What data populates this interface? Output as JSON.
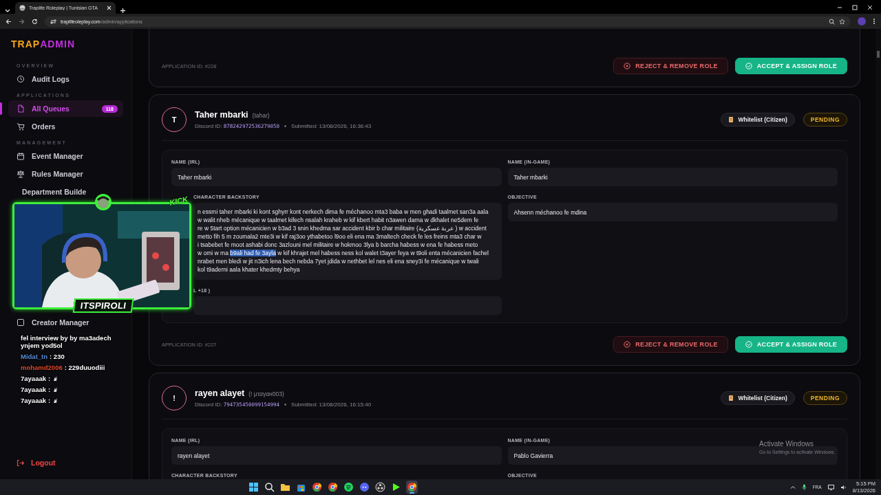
{
  "browser": {
    "tab_title": "Traplife Roleplay | Tunisian GTA",
    "url_host": "traplifeoleplay.com",
    "url_path": "/admin/applications"
  },
  "sidebar": {
    "logo_start": "TRAP",
    "logo_end": "ADMIN",
    "sections": [
      {
        "title": "OVERVIEW",
        "items": [
          {
            "label": "Audit Logs",
            "selected": false
          }
        ]
      },
      {
        "title": "APPLICATIONS",
        "items": [
          {
            "label": "All Queues",
            "selected": true,
            "badge": "118"
          },
          {
            "label": "Orders",
            "selected": false
          }
        ]
      },
      {
        "title": "MANAGEMENT",
        "items": [
          {
            "label": "Event Manager",
            "selected": false
          },
          {
            "label": "Rules Manager",
            "selected": false
          },
          {
            "label": "Department Builde",
            "selected": false,
            "partly_hidden": true
          },
          {
            "label": "Creator Manager",
            "selected": false
          }
        ]
      }
    ],
    "logout": "Logout"
  },
  "applications": [
    {
      "kind": "footer",
      "application_id": "APPLICATION ID: #228",
      "actions": [
        "REJECT & REMOVE ROLE",
        "ACCEPT & ASSIGN ROLE"
      ]
    },
    {
      "kind": "full",
      "initial": "T",
      "name": "Taher mbarki",
      "handle": "(tahar)",
      "discord_label": "Discord ID:",
      "discord_id": "878242972536279050",
      "submitted": "Submitted: 13/08/2026, 16:36:43",
      "role": "Whitelist (Citizen)",
      "status": "PENDING",
      "fields": [
        {
          "kind": "text",
          "label": "NAME (IRL)",
          "value": "Taher mbarki"
        },
        {
          "kind": "text",
          "label": "NAME (IN-GAME)",
          "value": "Taher mbarki"
        },
        {
          "kind": "multiline",
          "label": "CHARACTER BACKSTORY",
          "partly_hidden": true,
          "lines": [
            [
              {
                "text": "n essmi taher mbarki ki kont sghyrr kont nerkech dima fe méchanoo mta3 baba w men ghadi taalmet san3a aala",
                "selected": false
              }
            ],
            [
              {
                "text": "w walit nheb mécanique w taalmet kifech nsalah kraheb w kif kbert habit n3awen darna w dkhalet ne5dem fe",
                "selected": false
              }
            ],
            [
              {
                "text": "re w 5tart option mécanicien w b3ad 3 snin khedma sar accident kbir b char militaire (عربة عسكرية ) w accident",
                "selected": false
              }
            ],
            [
              {
                "text": "metto fih 5 m zoumala2 mte3i w kif raj3oo ythabetoo l9oo eli ena ma 3maltech check fe les freins mta3 char w",
                "selected": false
              }
            ],
            [
              {
                "text": "i tsabebet fe moot ashabi donc 3azlouni mel militaire w hokmoo 3lya b barcha habess w ena fe habess meto",
                "selected": false
              }
            ],
            [
              {
                "text": "w omi w ma ",
                "selected": false
              },
              {
                "text": "b9ali had fe 3ayla",
                "selected": true
              },
              {
                "text": " w kif khrajet mel habess ness kol walet t3ayer feya w t9oli enta mécanicien fachel",
                "selected": false
              }
            ],
            [
              {
                "text": "nrabet men bledi w jit n3ich lena bech nebda 7yet jdida w nethbet lel nes eli ena sney3i fe mécanique w twali",
                "selected": false
              }
            ],
            [
              {
                "text": "kol t9aderni aala khater khedmty behya",
                "selected": false
              }
            ]
          ]
        },
        {
          "kind": "text",
          "label": "OBJECTIVE",
          "value": "Ahsenn méchanoo fe mdina"
        },
        {
          "kind": "text",
          "label": "L +18 )",
          "partly_hidden": true
        }
      ],
      "application_id": "APPLICATION ID: #227",
      "actions": [
        "REJECT & REMOVE ROLE",
        "ACCEPT & ASSIGN ROLE"
      ]
    },
    {
      "kind": "full",
      "initial": "!",
      "name": "rayen alayet",
      "handle": "(! μταγαн003)",
      "discord_label": "Discord ID:",
      "discord_id": "794735450099154994",
      "submitted": "Submitted: 13/08/2026, 16:15:40",
      "role": "Whitelist (Citizen)",
      "status": "PENDING",
      "fields": [
        {
          "kind": "text",
          "label": "NAME (IRL)",
          "value": "rayen alayet"
        },
        {
          "kind": "text",
          "label": "NAME (IN-GAME)",
          "value": "Pablo Gavierra"
        },
        {
          "kind": "label",
          "label": "CHARACTER BACKSTORY"
        },
        {
          "kind": "label",
          "label": "OBJECTIVE"
        }
      ]
    }
  ],
  "stream_overlay": {
    "streamer": "ITSPIROLI",
    "platform": "KICK",
    "chat": [
      {
        "kind": "text",
        "message": "fel interview by by ma3adech ynjem yod5ol"
      },
      {
        "kind": "text",
        "user": "Midat_tn",
        "color": "#5b8ed8",
        "message": ": 230"
      },
      {
        "kind": "text",
        "user": "mohamd2006",
        "color": "#e04a2c",
        "message": ": 229duuodiii"
      },
      {
        "kind": "emote",
        "user": "7ayaaak",
        "color": "#ffffff",
        "message": ":"
      },
      {
        "kind": "emote",
        "user": "7ayaaak",
        "color": "#ffffff",
        "message": ":"
      },
      {
        "kind": "emote",
        "user": "7ayaaak",
        "color": "#ffffff",
        "message": ":"
      }
    ]
  },
  "os_notice": {
    "title": "Activate Windows",
    "text": "Go to Settings to activate Windows."
  },
  "taskbar": {
    "apps": [
      {
        "kind": "windows",
        "selected": false
      },
      {
        "kind": "search",
        "selected": false
      },
      {
        "kind": "folder",
        "selected": false
      },
      {
        "kind": "store",
        "selected": false
      },
      {
        "kind": "chrome",
        "selected": false
      },
      {
        "kind": "chrome",
        "selected": false
      },
      {
        "kind": "spotify",
        "selected": false
      },
      {
        "kind": "discord",
        "selected": false
      },
      {
        "kind": "obs",
        "selected": false
      },
      {
        "kind": "kick",
        "selected": false
      },
      {
        "kind": "chrome",
        "selected": true
      }
    ],
    "language": "FRA",
    "time": "5:15 PM",
    "date": "8/13/2026"
  }
}
